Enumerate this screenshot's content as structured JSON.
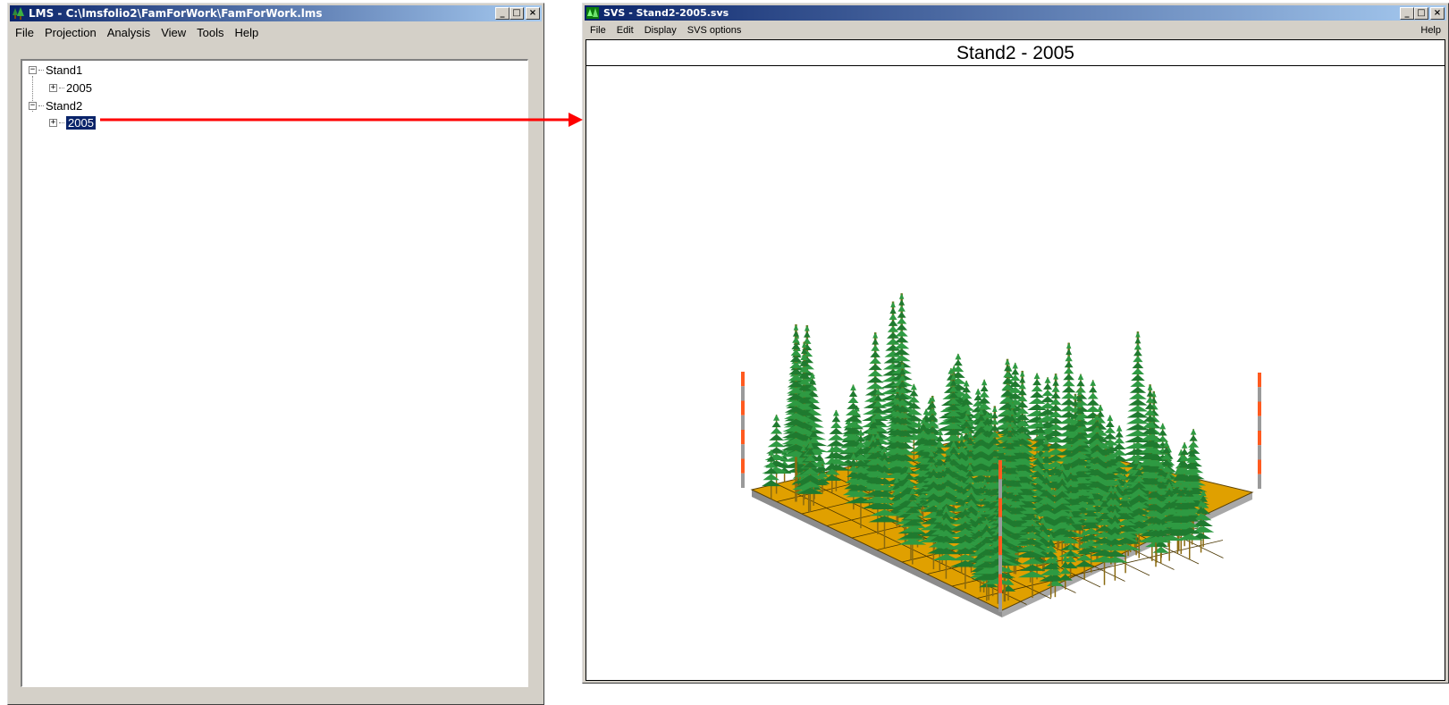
{
  "lms_window": {
    "title": "LMS - C:\\lmsfolio2\\FamForWork\\FamForWork.lms",
    "menu": [
      "File",
      "Projection",
      "Analysis",
      "View",
      "Tools",
      "Help"
    ],
    "tree": [
      {
        "label": "Stand1",
        "expanded": true,
        "children": [
          {
            "label": "2005",
            "expanded": false,
            "selected": false
          }
        ]
      },
      {
        "label": "Stand2",
        "expanded": true,
        "children": [
          {
            "label": "2005",
            "expanded": false,
            "selected": true
          }
        ]
      }
    ]
  },
  "svs_window": {
    "title": "SVS - Stand2-2005.svs",
    "menu": [
      "File",
      "Edit",
      "Display",
      "SVS options"
    ],
    "help": "Help",
    "view_title": "Stand2 - 2005"
  },
  "window_buttons": {
    "minimize": "_",
    "maximize": "□",
    "close": "×"
  },
  "colors": {
    "title_active": "#0a246a",
    "selection": "#0a246a",
    "arrow": "#ff0000",
    "ground": "#e0a000",
    "trunk": "#8a6a10",
    "foliage": "#1f7a2f",
    "pole_orange": "#ff5a1f",
    "pole_gray": "#9a9a9a"
  }
}
